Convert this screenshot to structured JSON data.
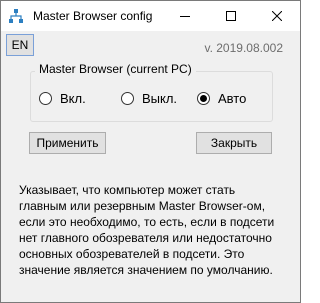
{
  "window": {
    "title": "Master Browser config"
  },
  "toolbar": {
    "lang_label": "EN",
    "version": "v. 2019.08.002"
  },
  "group": {
    "legend": "Master Browser (current PC)",
    "options": [
      {
        "label": "Вкл.",
        "checked": false
      },
      {
        "label": "Выкл.",
        "checked": false
      },
      {
        "label": "Авто",
        "checked": true
      }
    ]
  },
  "buttons": {
    "apply": "Применить",
    "close": "Закрыть"
  },
  "description": "Указывает, что компьютер может стать\nглавным или резервным Master Browser-ом,\nесли это необходимо, то есть, если в подсети\nнет главного обозревателя или недостаточно\nосновных обозревателей в подсети. Это\nзначение является значением по умолчанию.",
  "icons": {
    "app": "network-icon",
    "minimize": "minimize-icon",
    "maximize": "maximize-icon",
    "close": "close-icon"
  }
}
